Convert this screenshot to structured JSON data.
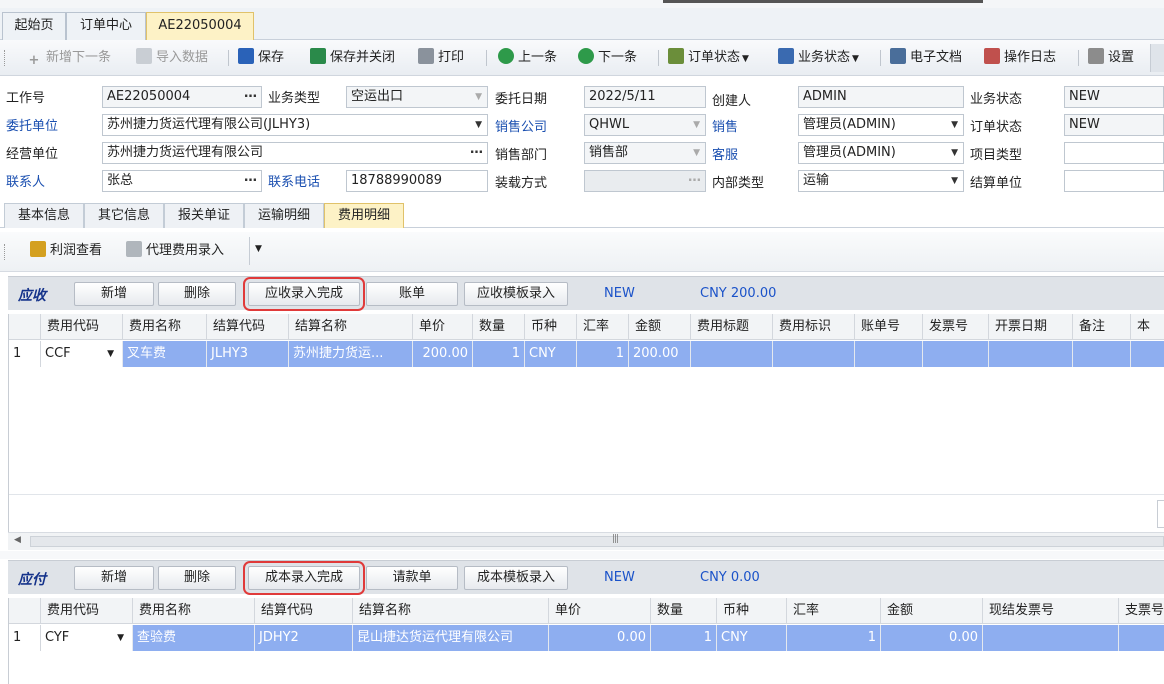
{
  "doc_tabs": [
    {
      "label": "起始页"
    },
    {
      "label": "订单中心"
    },
    {
      "label": "AE22050004"
    }
  ],
  "toolbar": {
    "new_next": "新增下一条",
    "import": "导入数据",
    "save": "保存",
    "save_close": "保存并关闭",
    "print": "打印",
    "prev": "上一条",
    "next": "下一条",
    "order_status": "订单状态",
    "business_status": "业务状态",
    "e_docs": "电子文档",
    "op_log": "操作日志",
    "settings": "设置"
  },
  "form": {
    "job_no": {
      "label": "工作号",
      "value": "AE22050004"
    },
    "business_type": {
      "label": "业务类型",
      "value": "空运出口"
    },
    "entrust_date": {
      "label": "委托日期",
      "value": "2022/5/11"
    },
    "creator": {
      "label": "创建人",
      "value": "ADMIN"
    },
    "business_status": {
      "label": "业务状态",
      "value": "NEW"
    },
    "client": {
      "label": "委托单位",
      "value": "苏州捷力货运代理有限公司(JLHY3)"
    },
    "sales_company": {
      "label": "销售公司",
      "value": "QHWL"
    },
    "sales": {
      "label": "销售",
      "value": "管理员(ADMIN)"
    },
    "order_status": {
      "label": "订单状态",
      "value": "NEW"
    },
    "operator_unit": {
      "label": "经营单位",
      "value": "苏州捷力货运代理有限公司"
    },
    "sales_dept": {
      "label": "销售部门",
      "value": "销售部"
    },
    "service": {
      "label": "客服",
      "value": "管理员(ADMIN)"
    },
    "project_type": {
      "label": "项目类型",
      "value": ""
    },
    "contact": {
      "label": "联系人",
      "value": "张总"
    },
    "phone": {
      "label": "联系电话",
      "value": "18788990089"
    },
    "loading_method": {
      "label": "装载方式",
      "value": ""
    },
    "internal_type": {
      "label": "内部类型",
      "value": "运输"
    },
    "settle_unit": {
      "label": "结算单位",
      "value": ""
    }
  },
  "sub_tabs": [
    {
      "label": "基本信息"
    },
    {
      "label": "其它信息"
    },
    {
      "label": "报关单证"
    },
    {
      "label": "运输明细"
    },
    {
      "label": "费用明细"
    }
  ],
  "toolbar2": {
    "profit_view": "利润查看",
    "agent_fee": "代理费用录入"
  },
  "receivable": {
    "title": "应收",
    "add": "新增",
    "delete": "删除",
    "complete": "应收录入完成",
    "bill": "账单",
    "template": "应收模板录入",
    "status": "NEW",
    "total": "CNY 200.00",
    "columns": [
      "费用代码",
      "费用名称",
      "结算代码",
      "结算名称",
      "单价",
      "数量",
      "币种",
      "汇率",
      "金额",
      "费用标题",
      "费用标识",
      "账单号",
      "发票号",
      "开票日期",
      "备注",
      "本"
    ],
    "rows": [
      {
        "idx": "1",
        "code": "CCF",
        "name": "叉车费",
        "settle_code": "JLHY3",
        "settle_name": "苏州捷力货运...",
        "price": "200.00",
        "qty": "1",
        "currency": "CNY",
        "rate": "1",
        "amount": "200.00"
      }
    ]
  },
  "payable": {
    "title": "应付",
    "add": "新增",
    "delete": "删除",
    "complete": "成本录入完成",
    "request": "请款单",
    "template": "成本模板录入",
    "status": "NEW",
    "total": "CNY 0.00",
    "columns": [
      "费用代码",
      "费用名称",
      "结算代码",
      "结算名称",
      "单价",
      "数量",
      "币种",
      "汇率",
      "金额",
      "现结发票号",
      "支票号"
    ],
    "rows": [
      {
        "idx": "1",
        "code": "CYF",
        "name": "查验费",
        "settle_code": "JDHY2",
        "settle_name": "昆山捷达货运代理有限公司",
        "price": "0.00",
        "qty": "1",
        "currency": "CNY",
        "rate": "1",
        "amount": "0.00"
      }
    ]
  },
  "colors": {
    "accent_blue": "#1a4fb0",
    "selected_row": "#8eaef0",
    "active_tab": "#fdf2c6",
    "highlight_red": "#e03a3a"
  }
}
